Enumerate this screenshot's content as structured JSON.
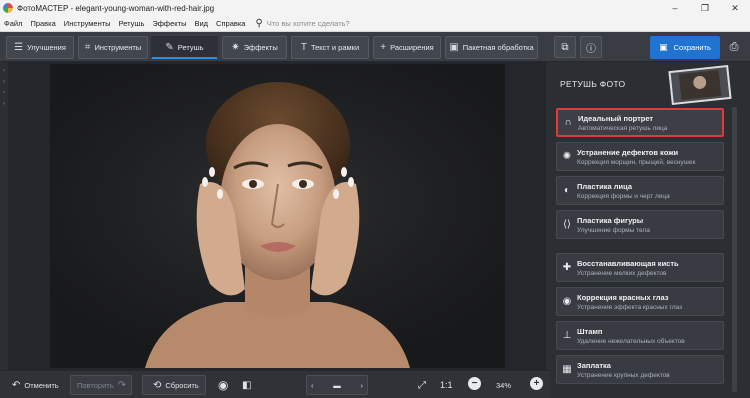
{
  "window": {
    "app_name": "ФотоМАСТЕР",
    "separator": " - ",
    "file_name": "elegant-young-woman-with-red-hair.jpg",
    "controls": [
      "–",
      "❐",
      "✕"
    ]
  },
  "menu": {
    "items": [
      "Файл",
      "Правка",
      "Инструменты",
      "Ретушь",
      "Эффекты",
      "Вид",
      "Справка"
    ],
    "search_placeholder": "Что вы хотите сделать?"
  },
  "toolbar": {
    "tabs": [
      {
        "label": "Улучшения",
        "icon": "sliders-icon",
        "glyph": "☰",
        "active": false
      },
      {
        "label": "Инструменты",
        "icon": "crop-icon",
        "glyph": "⌗",
        "active": false
      },
      {
        "label": "Ретушь",
        "icon": "brush-icon",
        "glyph": "✎",
        "active": true
      },
      {
        "label": "Эффекты",
        "icon": "sparkle-icon",
        "glyph": "✷",
        "active": false
      },
      {
        "label": "Текст и рамки",
        "icon": "text-icon",
        "glyph": "T",
        "active": false
      },
      {
        "label": "Расширения",
        "icon": "plus-icon",
        "glyph": "+",
        "active": false
      },
      {
        "label": "Пакетная обработка",
        "icon": "batch-icon",
        "glyph": "▣",
        "active": false
      }
    ],
    "save_label": "Сохранить",
    "accent_color": "#1f73d1"
  },
  "panel": {
    "title": "РЕТУШЬ ФОТО",
    "group1": [
      {
        "title": "Идеальный портрет",
        "subtitle": "Автоматическая ретушь лица",
        "icon": "portrait-icon",
        "glyph": "∩",
        "selected": true
      },
      {
        "title": "Устранение дефектов кожи",
        "subtitle": "Коррекция морщин, прыщей, веснушек",
        "icon": "skin-defects-icon",
        "glyph": "✺",
        "selected": false
      },
      {
        "title": "Пластика лица",
        "subtitle": "Коррекция формы и черт лица",
        "icon": "face-shape-icon",
        "glyph": "◐",
        "selected": false
      },
      {
        "title": "Пластика фигуры",
        "subtitle": "Улучшение формы тела",
        "icon": "body-shape-icon",
        "glyph": "⟨⟩",
        "selected": false
      }
    ],
    "group2": [
      {
        "title": "Восстанавливающая кисть",
        "subtitle": "Устранение мелких дефектов",
        "icon": "healing-brush-icon",
        "glyph": "✚",
        "selected": false
      },
      {
        "title": "Коррекция красных глаз",
        "subtitle": "Устранение эффекта красных глаз",
        "icon": "red-eye-icon",
        "glyph": "◉",
        "selected": false
      },
      {
        "title": "Штамп",
        "subtitle": "Удаление нежелательных объектов",
        "icon": "stamp-icon",
        "glyph": "⊥",
        "selected": false
      },
      {
        "title": "Заплатка",
        "subtitle": "Устранение крупных дефектов",
        "icon": "patch-icon",
        "glyph": "▦",
        "selected": false
      }
    ],
    "selected_border_color": "#e03b3b"
  },
  "bottom": {
    "undo_label": "Отменить",
    "redo_label": "Повторить",
    "reset_label": "Сбросить",
    "ratio_label": "1:1",
    "zoom": "34%"
  }
}
